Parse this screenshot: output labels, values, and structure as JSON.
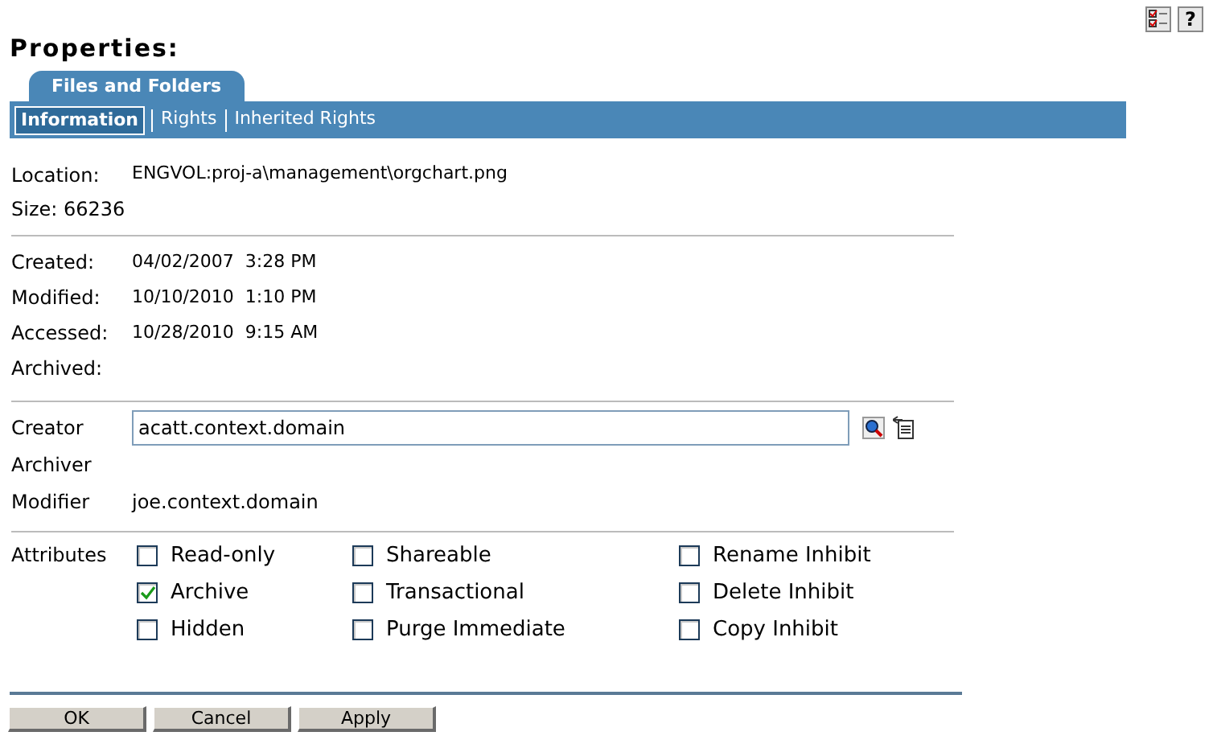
{
  "title": "Properties:",
  "tab": {
    "label": "Files and Folders"
  },
  "subtabs": [
    {
      "label": "Information",
      "selected": true
    },
    {
      "label": "Rights",
      "selected": false
    },
    {
      "label": "Inherited Rights",
      "selected": false
    }
  ],
  "info": [
    {
      "label": "Location:",
      "value": "ENGVOL:proj-a\\management\\orgchart.png"
    },
    {
      "label": "Size: 66236"
    }
  ],
  "dates": [
    {
      "label": "Created:",
      "value": "04/02/2007  3:28 PM"
    },
    {
      "label": "Modified:",
      "value": "10/10/2010  1:10 PM"
    },
    {
      "label": "Accessed:",
      "value": "10/28/2010  9:15 AM"
    },
    {
      "label": "Archived:"
    }
  ],
  "users": [
    {
      "label": "Creator",
      "kind": "field",
      "value": "acatt.context.domain"
    },
    {
      "label": "Archiver",
      "kind": "text"
    },
    {
      "label": "Modifier",
      "kind": "text",
      "value": "joe.context.domain"
    }
  ],
  "attributes": {
    "label": "Attributes",
    "items": [
      {
        "label": "Read-only",
        "checked": false
      },
      {
        "label": "Shareable",
        "checked": false
      },
      {
        "label": "Rename Inhibit",
        "checked": false
      },
      {
        "label": "Archive",
        "checked": true
      },
      {
        "label": "Transactional",
        "checked": false
      },
      {
        "label": "Delete Inhibit",
        "checked": false
      },
      {
        "label": "Hidden",
        "checked": false
      },
      {
        "label": "Purge Immediate",
        "checked": false
      },
      {
        "label": "Copy Inhibit",
        "checked": false
      }
    ]
  },
  "buttons": [
    "OK",
    "Cancel",
    "Apply"
  ],
  "help_button": "?"
}
